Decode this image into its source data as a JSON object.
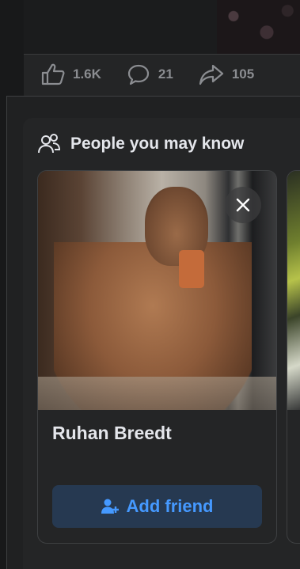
{
  "post": {
    "likes": "1.6K",
    "comments": "21",
    "shares": "105"
  },
  "pymk": {
    "title": "People you may know",
    "cards": [
      {
        "name": "Ruhan Breedt",
        "action_label": "Add friend"
      }
    ]
  },
  "colors": {
    "background": "#18191a",
    "card": "#242526",
    "accent": "#4599ff",
    "button_bg": "#263951",
    "text_primary": "#e4e6eb",
    "text_secondary": "#8b8d91"
  }
}
